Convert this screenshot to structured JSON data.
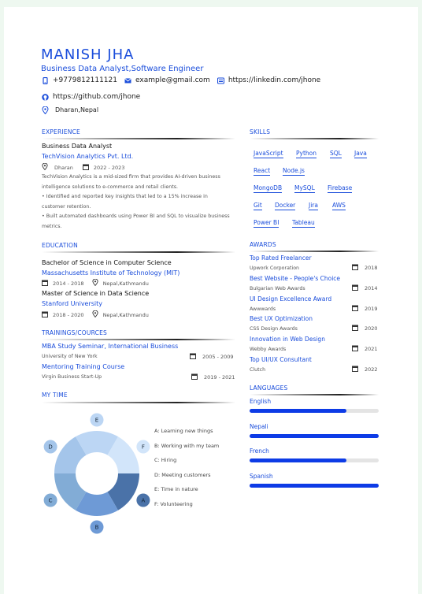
{
  "header": {
    "name": "MANISH JHA",
    "role": "Business Data Analyst,Software Engineer",
    "phone": "+9779812111121",
    "email": "example@gmail.com",
    "linkedin": "https://linkedin.com/jhone",
    "github": "https://github.com/jhone",
    "location": "Dharan,Nepal"
  },
  "experience": {
    "heading": "EXPERIENCE",
    "title": "Business Data Analyst",
    "company": "TechVision Analytics Pvt. Ltd.",
    "location": "Dharan",
    "dates": "2022 - 2023",
    "desc1": "TechVision Analytics is a mid-sized firm that provides AI-driven business intelligence solutions to e-commerce and retail clients.",
    "desc2": "• Identified and reported key insights that led to a 15% increase in customer retention.",
    "desc3": "• Built automated dashboards using Power BI and SQL to visualize business metrics."
  },
  "education": {
    "heading": "EDUCATION",
    "items": [
      {
        "degree": "Bachelor of Science in Computer Science",
        "school": "Massachusetts Institute of Technology (MIT)",
        "dates": "2014 - 2018",
        "location": "Nepal,Kathmandu"
      },
      {
        "degree": "Master of Science in Data Science",
        "school": "Stanford University",
        "dates": "2018 - 2020",
        "location": "Nepal,Kathmandu"
      }
    ]
  },
  "trainings": {
    "heading": "TRAININGS/COURCES",
    "items": [
      {
        "title": "MBA Study Seminar, International Business",
        "org": "University of New York",
        "dates": "2005 - 2009"
      },
      {
        "title": "Mentoring Training Course",
        "org": "Virgin Business Start-Up",
        "dates": "2019 - 2021"
      }
    ]
  },
  "my_time": {
    "heading": "MY TIME",
    "legend": [
      {
        "letter": "A",
        "text": "A: Learning new things",
        "color": "#4a72a8",
        "value": 1
      },
      {
        "letter": "B",
        "text": "B: Working with my team",
        "color": "#6e9ad6",
        "value": 1
      },
      {
        "letter": "C",
        "text": "C: Hiring",
        "color": "#82acd6",
        "value": 1
      },
      {
        "letter": "D",
        "text": "D: Meeting customers",
        "color": "#a4c5ea",
        "value": 1
      },
      {
        "letter": "E",
        "text": "E: Time in nature",
        "color": "#bcd6f4",
        "value": 1
      },
      {
        "letter": "F",
        "text": "F: Volunteering",
        "color": "#d2e5fa",
        "value": 1
      }
    ]
  },
  "skills": {
    "heading": "SKILLS",
    "items": [
      "JavaScript",
      "Python",
      "SQL",
      "Java",
      "React",
      "Node.js",
      "MongoDB",
      "MySQL",
      "Firebase",
      "Git",
      "Docker",
      "Jira",
      "AWS",
      "Power BI",
      "Tableau"
    ]
  },
  "awards": {
    "heading": "AWARDS",
    "items": [
      {
        "title": "Top Rated Freelancer",
        "org": "Upwork Corporation",
        "year": "2018"
      },
      {
        "title": "Best Website - People's Choice",
        "org": "Bulgarian Web Awards",
        "year": "2014"
      },
      {
        "title": "UI Design Excellence Award",
        "org": "Awwwards",
        "year": "2019"
      },
      {
        "title": "Best UX Optimization",
        "org": "CSS Design Awards",
        "year": "2020"
      },
      {
        "title": "Innovation in Web Design",
        "org": "Webby Awards",
        "year": "2021"
      },
      {
        "title": "Top UI/UX Consultant",
        "org": "Clutch",
        "year": "2022"
      }
    ]
  },
  "languages": {
    "heading": "LANGUAGES",
    "items": [
      {
        "name": "English",
        "level": 0.75
      },
      {
        "name": "Nepali",
        "level": 1.0
      },
      {
        "name": "French",
        "level": 0.75
      },
      {
        "name": "Spanish",
        "level": 1.0
      }
    ]
  },
  "colors": {
    "accent": "#1a4ddb",
    "bar_fill": "#0d3be6"
  }
}
